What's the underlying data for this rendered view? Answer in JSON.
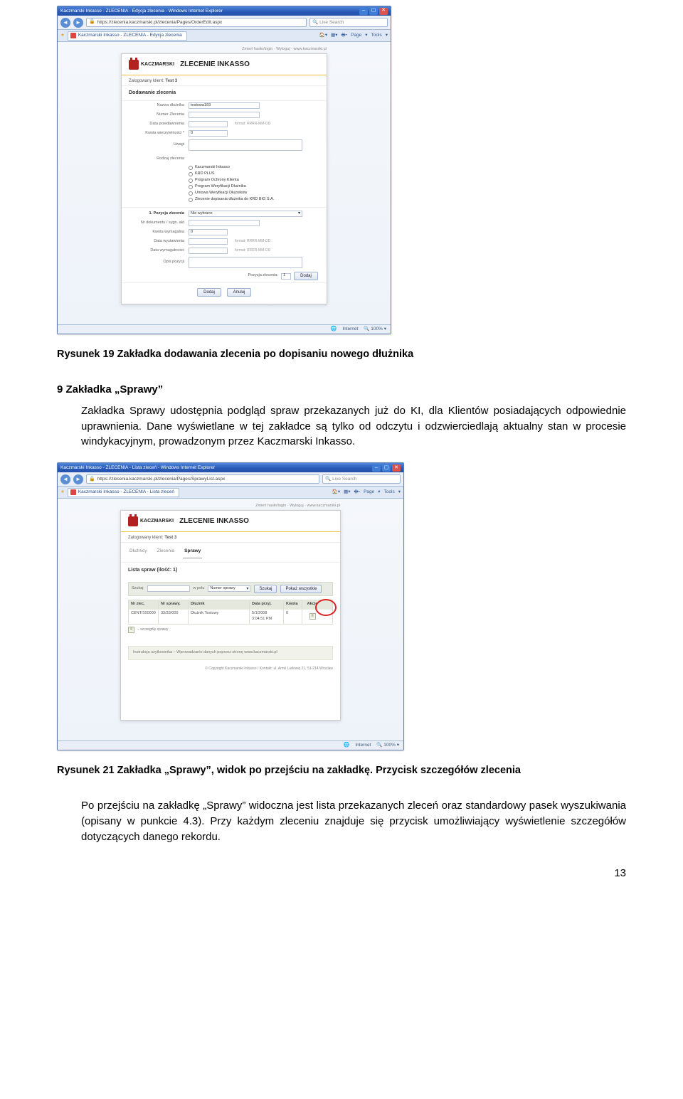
{
  "shot1": {
    "ie_title": "Kaczmarski Inkasso - ZLECENIA - Edycja zlecenia - Windows Internet Explorer",
    "url": "https://zlecenia.kaczmarski.pl/zlecenia/Pages/OrderEdit.aspx",
    "search_ph": "Live Search",
    "tab": "Kaczmarski Inkasso - ZLECENIA - Edycja zlecenia",
    "toolbar": {
      "home": "🏠",
      "feeds": "▾",
      "print": "🖶",
      "page": "Page",
      "tools": "Tools"
    },
    "topmeta": "Zmień hasło/login · Wyloguj · www.kaczmarski.pl",
    "logo_text": "KACZMARSKI",
    "app_title": "ZLECENIE INKASSO",
    "loggedin_lbl": "Zalogowany klient:",
    "loggedin_val": "Test 3",
    "section": "Dodawanie zlecenia",
    "f_nazwa": {
      "lbl": "Nazwa dłużnika",
      "val": "testowa193"
    },
    "f_nrzlec": {
      "lbl": "Numer Zlecenia"
    },
    "f_dataprz": {
      "lbl": "Data przedawnienia",
      "hint": "format: RRRR-MM-DD"
    },
    "f_kwota": {
      "lbl": "Kwota wierzytelności *",
      "val": "0"
    },
    "f_uwagi": {
      "lbl": "Uwagi"
    },
    "f_rodzaj": {
      "lbl": "Rodzaj zlecenia"
    },
    "radios": [
      "Kaczmarski Inkasso",
      "KRD PLUS",
      "Program Ochrony Klienta",
      "Program Weryfikacji Dłużnika",
      "Umowa Weryfikacji Dłużników",
      "Zlecenie dopisania dłużnika do KRD BIG S.A."
    ],
    "pos_hdr": "1. Pozycja zlecenia",
    "pos_sel": "Nie wybrano",
    "f_nrdok": {
      "lbl": "Nr dokumentu / sygn. akt"
    },
    "f_kwym": {
      "lbl": "Kwota wymagalna",
      "val": "0"
    },
    "f_dwyst": {
      "lbl": "Data wystawienia",
      "hint": "format: RRRR-MM-DD"
    },
    "f_dwym": {
      "lbl": "Data wymagalności",
      "hint": "format: RRRR-MM-DD"
    },
    "f_opis": {
      "lbl": "Opis pozycji"
    },
    "pos_lbl": "Pozycja zlecenia:",
    "pos_num": "1",
    "btn_add": "Dodaj",
    "btn_cancel": "Anuluj",
    "status_internet": "Internet",
    "status_zoom": "100%"
  },
  "caption1": "Rysunek 19 Zakładka dodawania zlecenia po dopisaniu nowego dłużnika",
  "sec9_hdr": "9    Zakładka „Sprawy”",
  "sec9_para": "Zakładka Sprawy udostępnia podgląd spraw przekazanych już do KI, dla Klientów posiadających odpowiednie uprawnienia. Dane wyświetlane w tej zakładce są tylko od odczytu i odzwierciedlają aktualny stan w procesie windykacyjnym, prowadzonym przez Kaczmarski Inkasso.",
  "shot2": {
    "ie_title": "Kaczmarski Inkasso - ZLECENIA - Lista zleceń - Windows Internet Explorer",
    "url": "https://zlecenia.kaczmarski.pl/zlecenia/Pages/SprawyList.aspx",
    "search_ph": "Live Search",
    "tab": "Kaczmarski Inkasso - ZLECENIA - Lista zleceń",
    "topmeta": "Zmień hasło/login · Wyloguj · www.kaczmarski.pl",
    "logo_text": "KACZMARSKI",
    "app_title": "ZLECENIE INKASSO",
    "loggedin_lbl": "Zalogowany klient:",
    "loggedin_val": "Test 3",
    "apptabs": [
      "Dłużnicy",
      "Zlecenia",
      "Sprawy"
    ],
    "active_tab": "Sprawy",
    "list_head": "Lista spraw (ilość: 1)",
    "filter": {
      "lbl": "Szukaj",
      "wpolu": "w polu",
      "field": "Numer sprawy",
      "btn_search": "Szukaj",
      "btn_all": "Pokaż wszystkie"
    },
    "thead": [
      "Nr zlec.",
      "Nr sprawy.",
      "Dłużnik",
      "Data przyj.",
      "Kwota",
      "Akcje"
    ],
    "row": {
      "nrzlec": "CENT/100000",
      "nrspr": "33/33/000",
      "dluz": "Dłużnik Testowy",
      "data": "5/1/2008 3:04:51 PM",
      "kw": "0"
    },
    "legend": "– szczegóły sprawy",
    "instr": "Instrukcja użytkownika – Wprowadzanie danych poprzez stronę www.kaczmarski.pl",
    "copy": "© Copyright Kaczmarski Inkasso / Kontakt: ul. Armii Ludowej 21, 51-214 Wrocław",
    "status_internet": "Internet",
    "status_zoom": "100%"
  },
  "caption2": "Rysunek 21 Zakładka „Sprawy”, widok po przejściu na zakładkę. Przycisk szczegółów zlecenia",
  "para2": "Po przejściu na zakładkę „Sprawy” widoczna jest lista przekazanych zleceń oraz standardowy pasek wyszukiwania (opisany w punkcie 4.3). Przy każdym zleceniu znajduje się przycisk umożliwiający wyświetlenie szczegółów dotyczących danego rekordu.",
  "page_number": "13"
}
